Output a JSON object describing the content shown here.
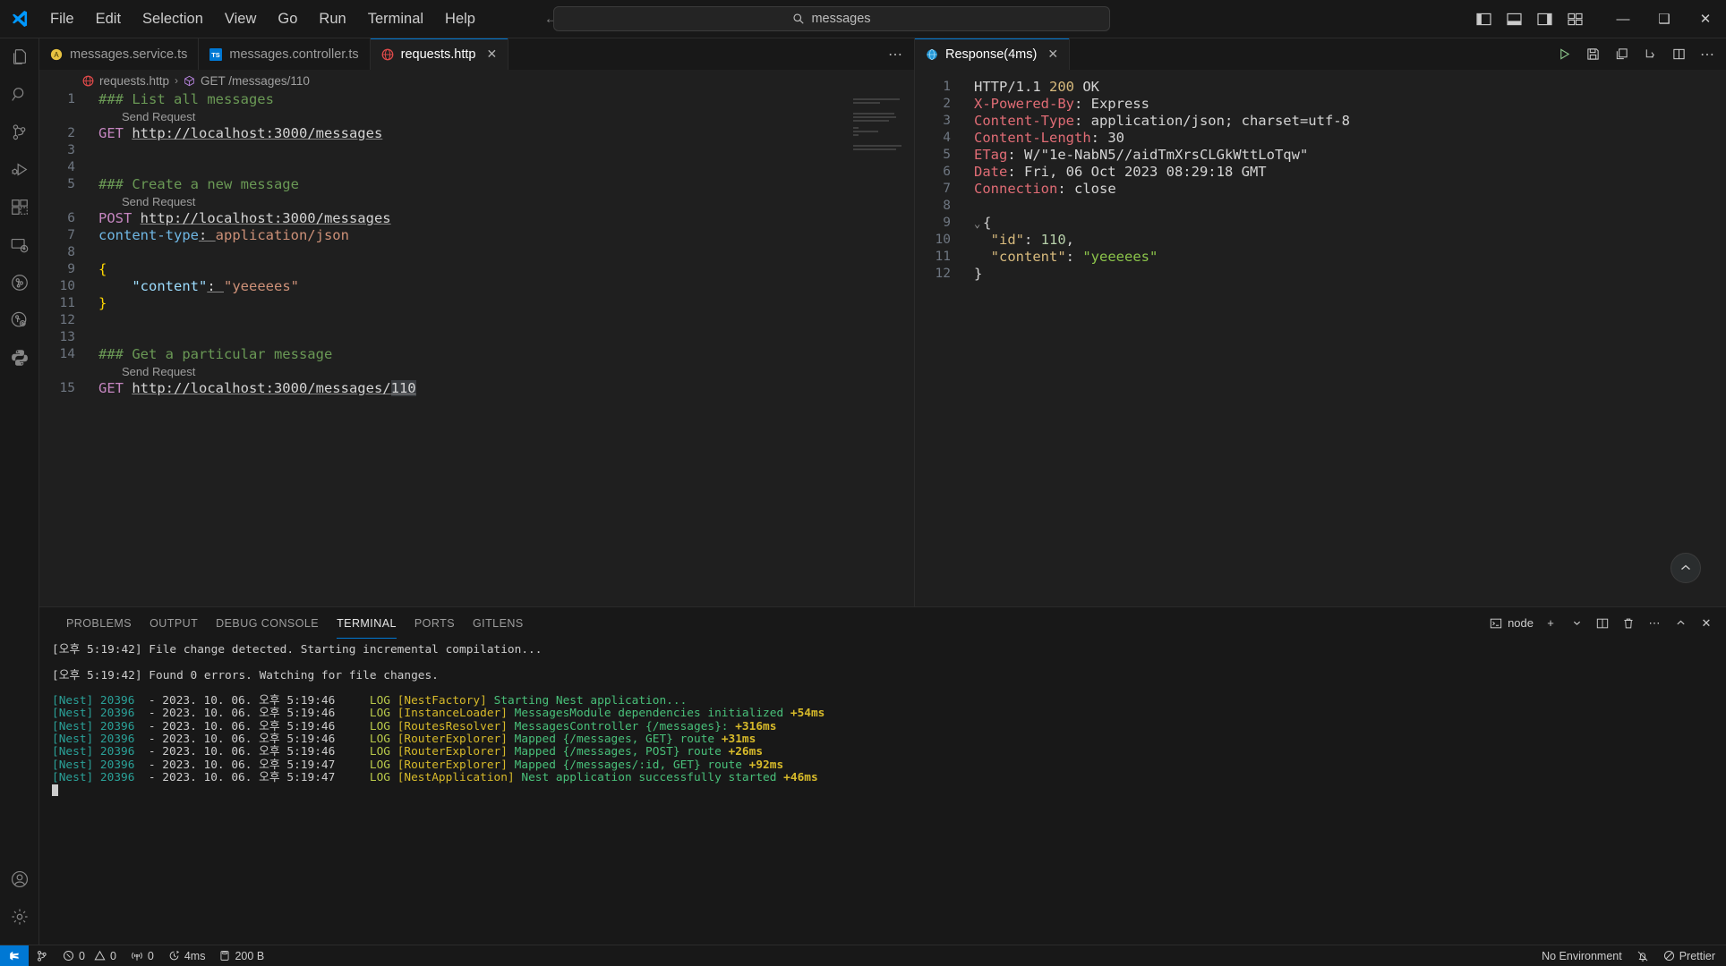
{
  "titlebar": {
    "menu": [
      "File",
      "Edit",
      "Selection",
      "View",
      "Go",
      "Run",
      "Terminal",
      "Help"
    ],
    "search_value": "messages",
    "search_icon": "search-icon",
    "back_icon": "arrow-left-icon",
    "forward_icon": "arrow-right-icon",
    "layout_icons": [
      "toggle-primary-sidebar-icon",
      "toggle-panel-icon",
      "toggle-secondary-sidebar-icon",
      "customize-layout-icon"
    ],
    "window_controls": {
      "minimize": "—",
      "maximize": "❑",
      "close": "✕"
    }
  },
  "activitybar": {
    "items": [
      {
        "name": "explorer",
        "title": "Explorer"
      },
      {
        "name": "search",
        "title": "Search"
      },
      {
        "name": "source-control",
        "title": "Source Control"
      },
      {
        "name": "run-and-debug",
        "title": "Run and Debug"
      },
      {
        "name": "extensions",
        "title": "Extensions"
      },
      {
        "name": "remote-explorer",
        "title": "Remote Explorer"
      },
      {
        "name": "gitlens",
        "title": "GitLens"
      },
      {
        "name": "gitlens-inspect",
        "title": "GitLens Inspect"
      },
      {
        "name": "python",
        "title": "Python"
      }
    ],
    "bottom": [
      {
        "name": "accounts",
        "title": "Accounts"
      },
      {
        "name": "settings",
        "title": "Manage"
      }
    ]
  },
  "editor_left": {
    "tabs": [
      {
        "label": "messages.service.ts",
        "icon": "angular-file-icon",
        "active": false,
        "dirty": false
      },
      {
        "label": "messages.controller.ts",
        "icon": "typescript-file-icon",
        "active": false,
        "dirty": false
      },
      {
        "label": "requests.http",
        "icon": "http-file-icon",
        "active": true,
        "dirty": false
      }
    ],
    "more_actions": "⋯",
    "breadcrumb": {
      "file": "requests.http",
      "separator": "›",
      "symbol": "GET /messages/110"
    },
    "codelens_label": "Send Request",
    "lines": [
      {
        "n": 1,
        "tokens": [
          {
            "t": "### List all messages",
            "c": "t-comment"
          }
        ]
      },
      {
        "n": 2,
        "tokens": [
          {
            "t": "GET ",
            "c": "t-method"
          },
          {
            "t": "http://localhost:3000/messages",
            "c": "t-url"
          }
        ]
      },
      {
        "n": 3,
        "tokens": []
      },
      {
        "n": 4,
        "tokens": []
      },
      {
        "n": 5,
        "tokens": [
          {
            "t": "### Create a new message",
            "c": "t-comment"
          }
        ]
      },
      {
        "n": 6,
        "tokens": [
          {
            "t": "POST ",
            "c": "t-method"
          },
          {
            "t": "http://localhost:3000/messages",
            "c": "t-url"
          }
        ]
      },
      {
        "n": 7,
        "tokens": [
          {
            "t": "content-type",
            "c": "t-header"
          },
          {
            "t": ": ",
            "c": "t-url"
          },
          {
            "t": "application/json",
            "c": "t-hdrval"
          }
        ]
      },
      {
        "n": 8,
        "tokens": []
      },
      {
        "n": 9,
        "tokens": [
          {
            "t": "{",
            "c": "t-brace"
          }
        ]
      },
      {
        "n": 10,
        "tokens": [
          {
            "t": "    \"content\"",
            "c": "t-key"
          },
          {
            "t": ": ",
            "c": "t-url"
          },
          {
            "t": "\"yeeeees\"",
            "c": "t-str"
          }
        ]
      },
      {
        "n": 11,
        "tokens": [
          {
            "t": "}",
            "c": "t-brace"
          }
        ]
      },
      {
        "n": 12,
        "tokens": []
      },
      {
        "n": 13,
        "tokens": []
      },
      {
        "n": 14,
        "tokens": [
          {
            "t": "### Get a particular message",
            "c": "t-comment"
          }
        ]
      },
      {
        "n": 15,
        "tokens": [
          {
            "t": "GET ",
            "c": "t-method"
          },
          {
            "t": "http://localhost:3000/messages/",
            "c": "t-url"
          },
          {
            "t": "110",
            "c": "t-url sel"
          }
        ]
      }
    ],
    "codelens_on_lines": [
      1,
      5,
      14
    ]
  },
  "editor_right": {
    "tab": {
      "label": "Response(4ms)",
      "icon": "response-globe-icon",
      "close": "✕"
    },
    "actions": [
      "run-icon",
      "save-icon",
      "copy-icon",
      "fold-icon",
      "split-editor-icon",
      "more-actions-icon"
    ],
    "scroll_top_icon": "chevron-up-icon",
    "lines": [
      {
        "n": 1,
        "tokens": [
          {
            "t": "HTTP/1.1 ",
            "c": "r-status"
          },
          {
            "t": "200",
            "c": "r-code"
          },
          {
            "t": " OK",
            "c": "r-status"
          }
        ]
      },
      {
        "n": 2,
        "tokens": [
          {
            "t": "X-Powered-By",
            "c": "r-hdr"
          },
          {
            "t": ": Express",
            "c": "r-val"
          }
        ]
      },
      {
        "n": 3,
        "tokens": [
          {
            "t": "Content-Type",
            "c": "r-hdr"
          },
          {
            "t": ": application/json; charset=utf-8",
            "c": "r-val"
          }
        ]
      },
      {
        "n": 4,
        "tokens": [
          {
            "t": "Content-Length",
            "c": "r-hdr"
          },
          {
            "t": ": 30",
            "c": "r-val"
          }
        ]
      },
      {
        "n": 5,
        "tokens": [
          {
            "t": "ETag",
            "c": "r-hdr"
          },
          {
            "t": ": W/\"1e-NabN5//aidTmXrsCLGkWttLoTqw\"",
            "c": "r-val"
          }
        ]
      },
      {
        "n": 6,
        "tokens": [
          {
            "t": "Date",
            "c": "r-hdr"
          },
          {
            "t": ": Fri, 06 Oct 2023 08:29:18 GMT",
            "c": "r-val"
          }
        ]
      },
      {
        "n": 7,
        "tokens": [
          {
            "t": "Connection",
            "c": "r-hdr"
          },
          {
            "t": ": close",
            "c": "r-val"
          }
        ]
      },
      {
        "n": 8,
        "tokens": []
      },
      {
        "n": 9,
        "fold": true,
        "tokens": [
          {
            "t": "{",
            "c": "r-val"
          }
        ]
      },
      {
        "n": 10,
        "tokens": [
          {
            "t": "  \"id\"",
            "c": "r-key"
          },
          {
            "t": ": ",
            "c": "r-val"
          },
          {
            "t": "110",
            "c": "r-num"
          },
          {
            "t": ",",
            "c": "r-val"
          }
        ]
      },
      {
        "n": 11,
        "tokens": [
          {
            "t": "  \"content\"",
            "c": "r-key"
          },
          {
            "t": ": ",
            "c": "r-val"
          },
          {
            "t": "\"yeeeees\"",
            "c": "r-str"
          }
        ]
      },
      {
        "n": 12,
        "tokens": [
          {
            "t": "}",
            "c": "r-val"
          }
        ]
      }
    ]
  },
  "panel": {
    "tabs": [
      {
        "label": "PROBLEMS",
        "active": false
      },
      {
        "label": "OUTPUT",
        "active": false
      },
      {
        "label": "DEBUG CONSOLE",
        "active": false
      },
      {
        "label": "TERMINAL",
        "active": true
      },
      {
        "label": "PORTS",
        "active": false
      },
      {
        "label": "GITLENS",
        "active": false
      }
    ],
    "shell_label": "node",
    "actions": [
      "new-terminal-icon",
      "chevron-down-icon",
      "split-terminal-icon",
      "kill-terminal-icon",
      "more-actions-icon",
      "maximize-panel-icon",
      "close-panel-icon"
    ],
    "terminal_lines": [
      {
        "type": "tsc",
        "time": "[오후 5:19:42]",
        "text": " File change detected. Starting incremental compilation..."
      },
      {
        "type": "gap"
      },
      {
        "type": "tsc",
        "time": "[오후 5:19:42]",
        "text": " Found 0 errors. Watching for file changes."
      },
      {
        "type": "gap"
      },
      {
        "type": "nest",
        "prefix": "[Nest] 20396",
        "dash": "  - ",
        "date": "2023. 10. 06. 오후 5:19:46",
        "level": "LOG",
        "ctx": "[NestFactory]",
        "msg": " Starting Nest application...",
        "ms": ""
      },
      {
        "type": "nest",
        "prefix": "[Nest] 20396",
        "dash": "  - ",
        "date": "2023. 10. 06. 오후 5:19:46",
        "level": "LOG",
        "ctx": "[InstanceLoader]",
        "msg": " MessagesModule dependencies initialized ",
        "ms": "+54ms"
      },
      {
        "type": "nest",
        "prefix": "[Nest] 20396",
        "dash": "  - ",
        "date": "2023. 10. 06. 오후 5:19:46",
        "level": "LOG",
        "ctx": "[RoutesResolver]",
        "msg": " MessagesController {/messages}: ",
        "ms": "+316ms"
      },
      {
        "type": "nest",
        "prefix": "[Nest] 20396",
        "dash": "  - ",
        "date": "2023. 10. 06. 오후 5:19:46",
        "level": "LOG",
        "ctx": "[RouterExplorer]",
        "msg": " Mapped {/messages, GET} route ",
        "ms": "+31ms"
      },
      {
        "type": "nest",
        "prefix": "[Nest] 20396",
        "dash": "  - ",
        "date": "2023. 10. 06. 오후 5:19:46",
        "level": "LOG",
        "ctx": "[RouterExplorer]",
        "msg": " Mapped {/messages, POST} route ",
        "ms": "+26ms"
      },
      {
        "type": "nest",
        "prefix": "[Nest] 20396",
        "dash": "  - ",
        "date": "2023. 10. 06. 오후 5:19:47",
        "level": "LOG",
        "ctx": "[RouterExplorer]",
        "msg": " Mapped {/messages/:id, GET} route ",
        "ms": "+92ms"
      },
      {
        "type": "nest",
        "prefix": "[Nest] 20396",
        "dash": "  - ",
        "date": "2023. 10. 06. 오후 5:19:47",
        "level": "LOG",
        "ctx": "[NestApplication]",
        "msg": " Nest application successfully started ",
        "ms": "+46ms"
      },
      {
        "type": "cursor"
      }
    ]
  },
  "statusbar": {
    "remote_icon": "remote-window-icon",
    "branch_icon": "source-control-icon",
    "errors": "0",
    "warnings": "0",
    "ports": "0",
    "duration": "4ms",
    "size": "200 B",
    "environment": "No Environment",
    "bell_icon": "notifications-icon",
    "formatter": "Prettier"
  },
  "colors": {
    "accent": "#0078d4",
    "background": "#1f1f1f",
    "chrome": "#181818",
    "comment_green": "#6A9955",
    "method_purple": "#c586c0",
    "header_red": "#e06c75",
    "string_orange": "#ce9178"
  }
}
